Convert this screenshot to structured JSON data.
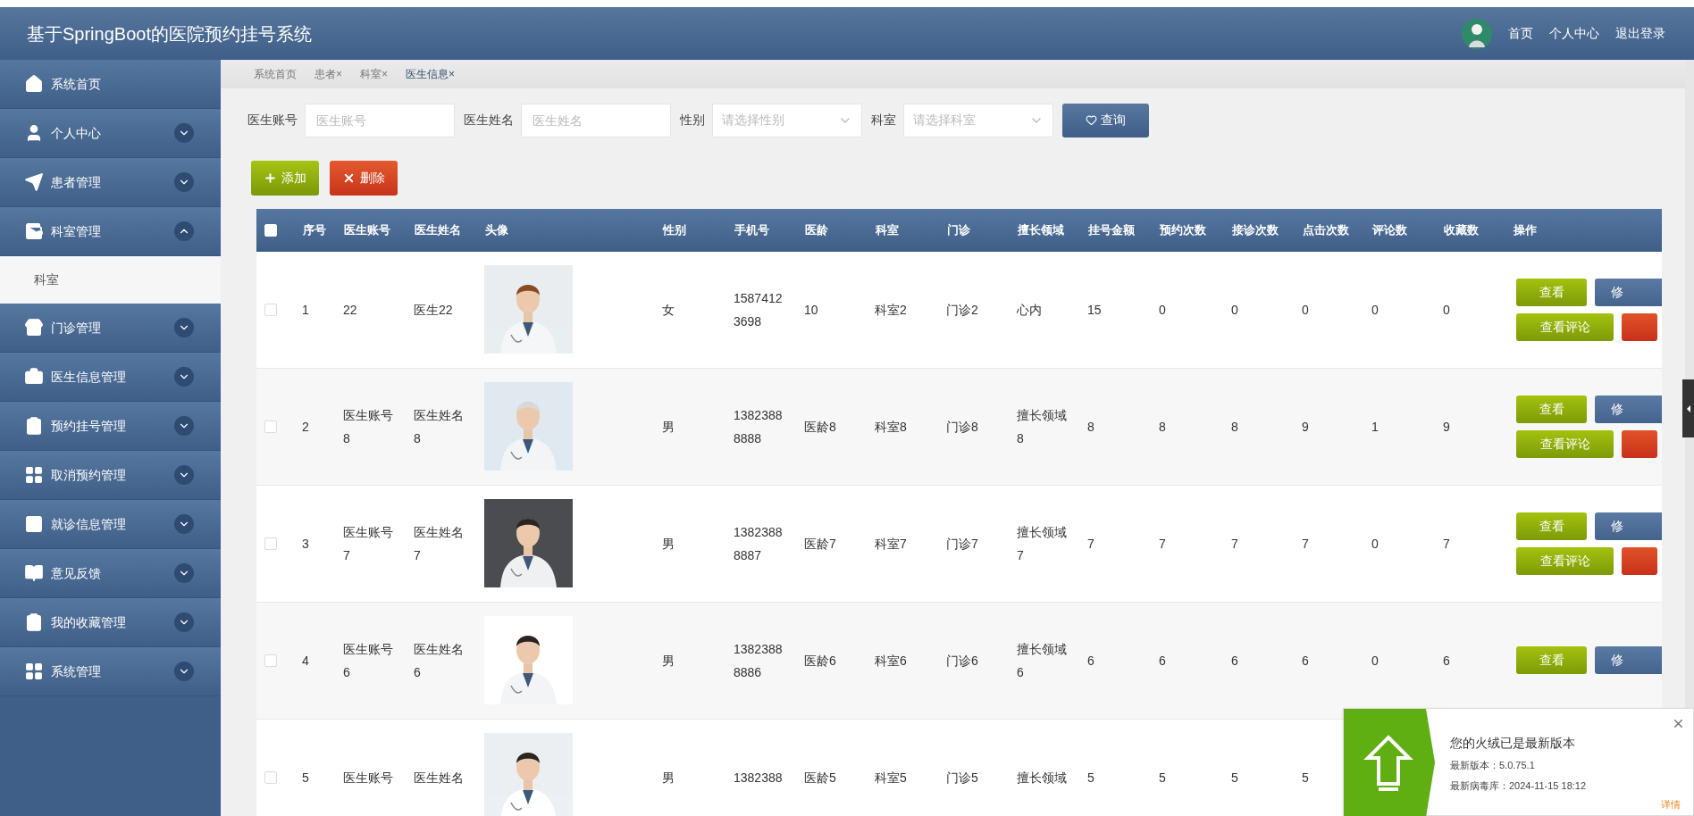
{
  "header": {
    "title": "基于SpringBoot的医院预约挂号系统",
    "links": [
      "首页",
      "个人中心",
      "退出登录"
    ]
  },
  "sidebar": {
    "items": [
      {
        "label": "系统首页"
      },
      {
        "label": "个人中心",
        "expanded": false
      },
      {
        "label": "患者管理",
        "expanded": false
      },
      {
        "label": "科室管理",
        "expanded": true,
        "children": [
          {
            "label": "科室"
          }
        ]
      },
      {
        "label": "门诊管理",
        "expanded": false
      },
      {
        "label": "医生信息管理",
        "expanded": false
      },
      {
        "label": "预约挂号管理",
        "expanded": false
      },
      {
        "label": "取消预约管理",
        "expanded": false
      },
      {
        "label": "就诊信息管理",
        "expanded": false
      },
      {
        "label": "意见反馈",
        "expanded": false
      },
      {
        "label": "我的收藏管理",
        "expanded": false
      },
      {
        "label": "系统管理",
        "expanded": false
      }
    ]
  },
  "breadcrumb_tabs": [
    {
      "label": "系统首页",
      "selected": false
    },
    {
      "label": "患者",
      "close": "×",
      "selected": false
    },
    {
      "label": "科室",
      "close": "×",
      "selected": false
    },
    {
      "label": "医生信息",
      "close": "×",
      "selected": true
    }
  ],
  "filters": [
    {
      "kind": "input",
      "label": "医生账号",
      "placeholder": "医生账号"
    },
    {
      "kind": "input",
      "label": "医生姓名",
      "placeholder": "医生姓名"
    },
    {
      "kind": "select",
      "label": "性别",
      "placeholder": "请选择性别"
    },
    {
      "kind": "select",
      "label": "科室",
      "placeholder": "请选择科室"
    }
  ],
  "search_button": "查询",
  "toolbar": [
    {
      "kind": "add",
      "label": "添加"
    },
    {
      "kind": "delete",
      "label": "删除"
    }
  ],
  "table": {
    "select_all": {
      "checked": false
    },
    "columns": [
      "序号",
      "医生账号",
      "医生姓名",
      "头像",
      "性别",
      "手机号",
      "医龄",
      "科室",
      "门诊",
      "擅长领域",
      "挂号金额",
      "预约次数",
      "接诊次数",
      "点击次数",
      "评论数",
      "收藏数",
      "操作"
    ],
    "rows": [
      {
        "checked": false,
        "cells": [
          "1",
          "22",
          "医生22",
          {
            "kind": "picture"
          },
          "女",
          "15874123698",
          "10",
          "科室2",
          "门诊2",
          "心内",
          "15",
          "0",
          "0",
          "0",
          "0",
          "0"
        ],
        "actions": [
          {
            "kind": "view",
            "label": "查看"
          },
          {
            "kind": "edit",
            "label": "修"
          },
          {
            "kind": "comments",
            "label": "查看评论"
          },
          {
            "kind": "delete"
          }
        ]
      },
      {
        "checked": false,
        "cells": [
          "2",
          "医生账号8",
          "医生姓名8",
          {
            "kind": "picture"
          },
          "男",
          "13823888888",
          "医龄8",
          "科室8",
          "门诊8",
          "擅长领域8",
          "8",
          "8",
          "8",
          "9",
          "1",
          "9"
        ],
        "actions": [
          {
            "kind": "view",
            "label": "查看"
          },
          {
            "kind": "edit",
            "label": "修"
          },
          {
            "kind": "comments",
            "label": "查看评论"
          },
          {
            "kind": "delete"
          }
        ]
      },
      {
        "checked": false,
        "cells": [
          "3",
          "医生账号7",
          "医生姓名7",
          {
            "kind": "picture"
          },
          "男",
          "13823888887",
          "医龄7",
          "科室7",
          "门诊7",
          "擅长领域7",
          "7",
          "7",
          "7",
          "7",
          "0",
          "7"
        ],
        "actions": [
          {
            "kind": "view",
            "label": "查看"
          },
          {
            "kind": "edit",
            "label": "修"
          },
          {
            "kind": "comments",
            "label": "查看评论"
          },
          {
            "kind": "delete"
          }
        ]
      },
      {
        "checked": false,
        "cells": [
          "4",
          "医生账号6",
          "医生姓名6",
          {
            "kind": "picture"
          },
          "男",
          "13823888886",
          "医龄6",
          "科室6",
          "门诊6",
          "擅长领域6",
          "6",
          "6",
          "6",
          "6",
          "0",
          "6"
        ],
        "actions": [
          {
            "kind": "view",
            "label": "查看"
          },
          {
            "kind": "edit",
            "label": "修"
          }
        ]
      },
      {
        "checked": false,
        "cells": [
          "5",
          "医生账号",
          "医生姓名",
          {
            "kind": "picture"
          },
          "男",
          "1382388",
          "医龄5",
          "科室5",
          "门诊5",
          "擅长领域",
          "5",
          "5",
          "5",
          "5"
        ],
        "actions": []
      }
    ]
  },
  "update_popup": {
    "title": "您的火绒已是最新版本",
    "lines": [
      "最新版本：5.0.75.1",
      "最新病毒库：2024-11-15 18:12"
    ],
    "link": "详情"
  }
}
